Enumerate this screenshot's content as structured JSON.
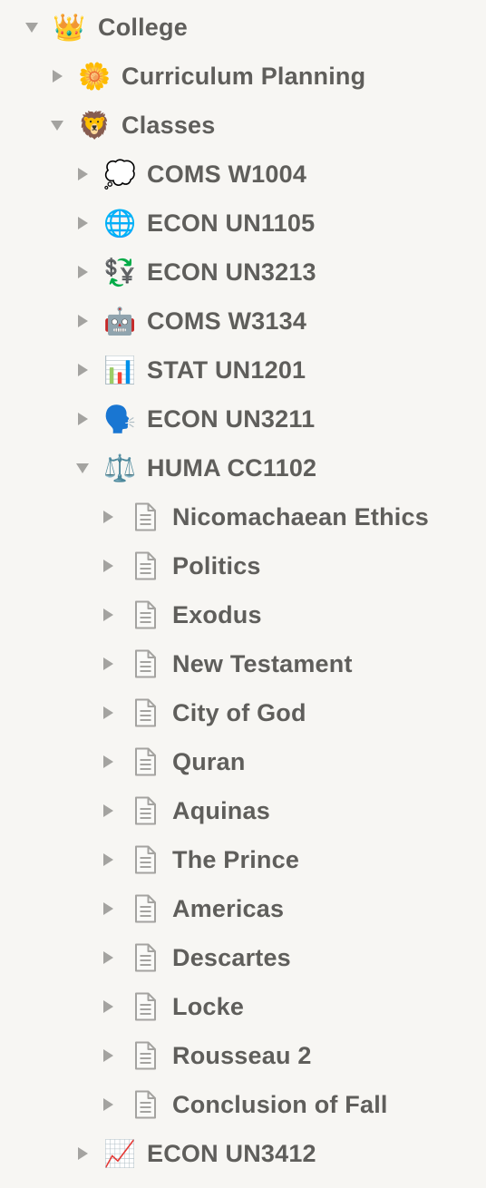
{
  "tree": {
    "root": {
      "label": "College",
      "icon": "crown-icon",
      "glyph": "👑",
      "expanded": true
    },
    "curriculum": {
      "label": "Curriculum Planning",
      "icon": "blossom-icon",
      "glyph": "🌼",
      "expanded": false
    },
    "classes": {
      "label": "Classes",
      "icon": "lion-icon",
      "glyph": "🦁",
      "expanded": true
    },
    "courses": [
      {
        "label": "COMS W1004",
        "icon": "thought-balloon-icon",
        "glyph": "💭"
      },
      {
        "label": "ECON UN1105",
        "icon": "globe-icon",
        "glyph": "🌐"
      },
      {
        "label": "ECON UN3213",
        "icon": "currency-exchange-icon",
        "glyph": "💱"
      },
      {
        "label": "COMS W3134",
        "icon": "robot-icon",
        "glyph": "🤖"
      },
      {
        "label": "STAT UN1201",
        "icon": "bar-chart-icon",
        "glyph": "📊"
      },
      {
        "label": "ECON UN3211",
        "icon": "speaking-head-icon",
        "glyph": "🗣️"
      }
    ],
    "huma": {
      "label": "HUMA CC1102",
      "icon": "balance-scale-icon",
      "glyph": "⚖️",
      "expanded": true
    },
    "huma_pages": [
      {
        "label": "Nicomachaean Ethics",
        "icon": "page-icon"
      },
      {
        "label": "Politics",
        "icon": "page-icon"
      },
      {
        "label": "Exodus",
        "icon": "page-icon"
      },
      {
        "label": "New Testament",
        "icon": "page-icon"
      },
      {
        "label": "City of God",
        "icon": "page-icon"
      },
      {
        "label": "Quran",
        "icon": "page-icon"
      },
      {
        "label": "Aquinas",
        "icon": "page-icon"
      },
      {
        "label": "The Prince",
        "icon": "page-icon"
      },
      {
        "label": "Americas",
        "icon": "page-icon"
      },
      {
        "label": "Descartes",
        "icon": "page-icon"
      },
      {
        "label": "Locke",
        "icon": "page-icon"
      },
      {
        "label": "Rousseau 2",
        "icon": "page-icon"
      },
      {
        "label": "Conclusion of Fall",
        "icon": "page-icon"
      }
    ],
    "last": {
      "label": "ECON UN3412",
      "icon": "chart-increasing-icon",
      "glyph": "📈",
      "expanded": false
    }
  }
}
